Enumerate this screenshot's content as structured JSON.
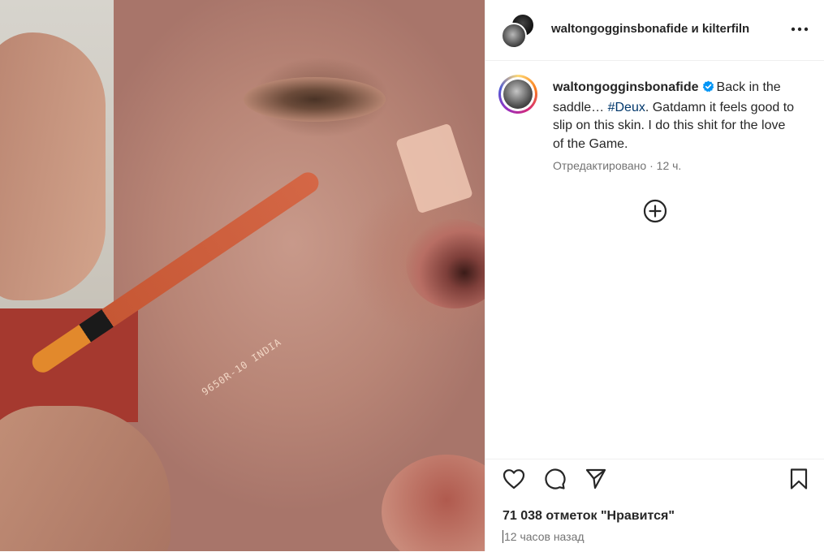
{
  "post": {
    "header": {
      "title": "waltongogginsbonafide и kilterfiln",
      "more_icon": "more-horizontal-icon"
    },
    "caption": {
      "username": "waltongogginsbonafide",
      "verified": true,
      "text_before": "Back in the saddle… ",
      "hashtag": "#Deux",
      "text_after": ". Gatdamn it feels good to slip on this skin. I do this shit for the love of the Game.",
      "edited": "Отредактировано",
      "separator": "·",
      "time_ago": "12 ч."
    },
    "add_icon": "plus-circle-icon",
    "actions": {
      "icons": [
        "heart-icon",
        "comment-icon",
        "share-icon",
        "bookmark-icon"
      ]
    },
    "likes_text": "71 038 отметок \"Нравится\"",
    "posted": "12 часов назад",
    "image": {
      "pencil_label": "9650R-10 INDIA"
    },
    "colors": {
      "link": "#00376b",
      "verified": "#0095f6",
      "secondary_text": "#737373"
    }
  }
}
